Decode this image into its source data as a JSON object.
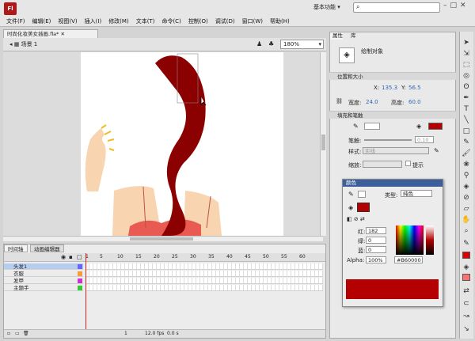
{
  "app": {
    "logo": "Fl",
    "workspace": "基本功能",
    "search_placeholder": ""
  },
  "menu": [
    "文件(F)",
    "编辑(E)",
    "视图(V)",
    "插入(I)",
    "修改(M)",
    "文本(T)",
    "命令(C)",
    "控制(O)",
    "调试(D)",
    "窗口(W)",
    "帮助(H)"
  ],
  "document": {
    "tab": "时尚化妆美女插画.fla*",
    "scene": "场景 1",
    "zoom": "180%"
  },
  "timeline": {
    "tabs": [
      "时间轴",
      "动画编辑器"
    ],
    "frame_numbers": [
      "1",
      "5",
      "10",
      "15",
      "20",
      "25",
      "30",
      "35",
      "40",
      "45",
      "50",
      "55",
      "60"
    ],
    "layers": [
      {
        "name": "头发1",
        "selected": true,
        "color": "#6666ff"
      },
      {
        "name": "衣服",
        "color": "#ff9933"
      },
      {
        "name": "发甲",
        "color": "#cc33cc"
      },
      {
        "name": "主题手",
        "color": "#33cc33"
      }
    ],
    "footer": {
      "frame": "1",
      "fps": "12.0 fps",
      "time": "0.0 s"
    }
  },
  "properties": {
    "tab1": "属性",
    "tab2": "库",
    "object_label": "绘制对象",
    "section_pos": "位置和大小",
    "x_label": "X:",
    "x": "135.3",
    "y_label": "Y:",
    "y": "56.5",
    "w_label": "宽度:",
    "w": "24.0",
    "h_label": "高度:",
    "h": "60.0",
    "section_fill": "填充和笔触",
    "stroke_label": "笔触:",
    "stroke_value": "0.10",
    "style_label": "样式:",
    "style_value": "实线",
    "scale_label": "缩放:",
    "hint_label": "提示"
  },
  "color_panel": {
    "title": "颜色",
    "type_label": "类型:",
    "type_value": "纯色",
    "r_label": "红:",
    "r": "182",
    "g_label": "绿:",
    "g": "0",
    "b_label": "蓝:",
    "b": "0",
    "alpha_label": "Alpha:",
    "alpha": "100%",
    "hex": "#B60000",
    "fill_color": "#b40000"
  }
}
